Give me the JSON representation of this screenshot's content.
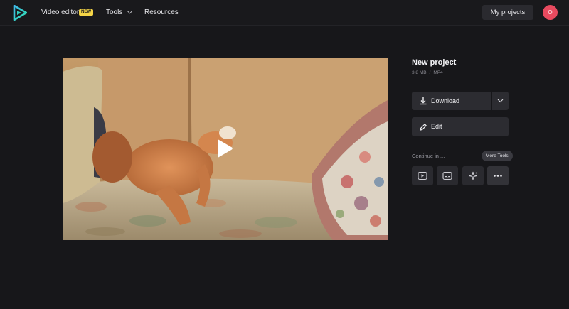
{
  "header": {
    "nav": {
      "video_editor": "Video editor",
      "new_badge": "NEW",
      "tools": "Tools",
      "resources": "Resources"
    },
    "my_projects": "My projects",
    "avatar_initial": "O",
    "logo_icon": "play-triangle-logo"
  },
  "project": {
    "title": "New project",
    "size": "3.8 MB",
    "format": "MP4"
  },
  "actions": {
    "download": "Download",
    "edit": "Edit"
  },
  "continue": {
    "label": "Continue in ...",
    "tooltip": "More Tools",
    "tools": [
      {
        "icon": "video-player-icon"
      },
      {
        "icon": "subtitles-icon"
      },
      {
        "icon": "sparkle-icon"
      },
      {
        "icon": "more-dots-icon"
      }
    ]
  },
  "colors": {
    "background": "#17171a",
    "button": "#2c2c31",
    "avatar": "#e84a5f",
    "badge": "#f5d547"
  }
}
